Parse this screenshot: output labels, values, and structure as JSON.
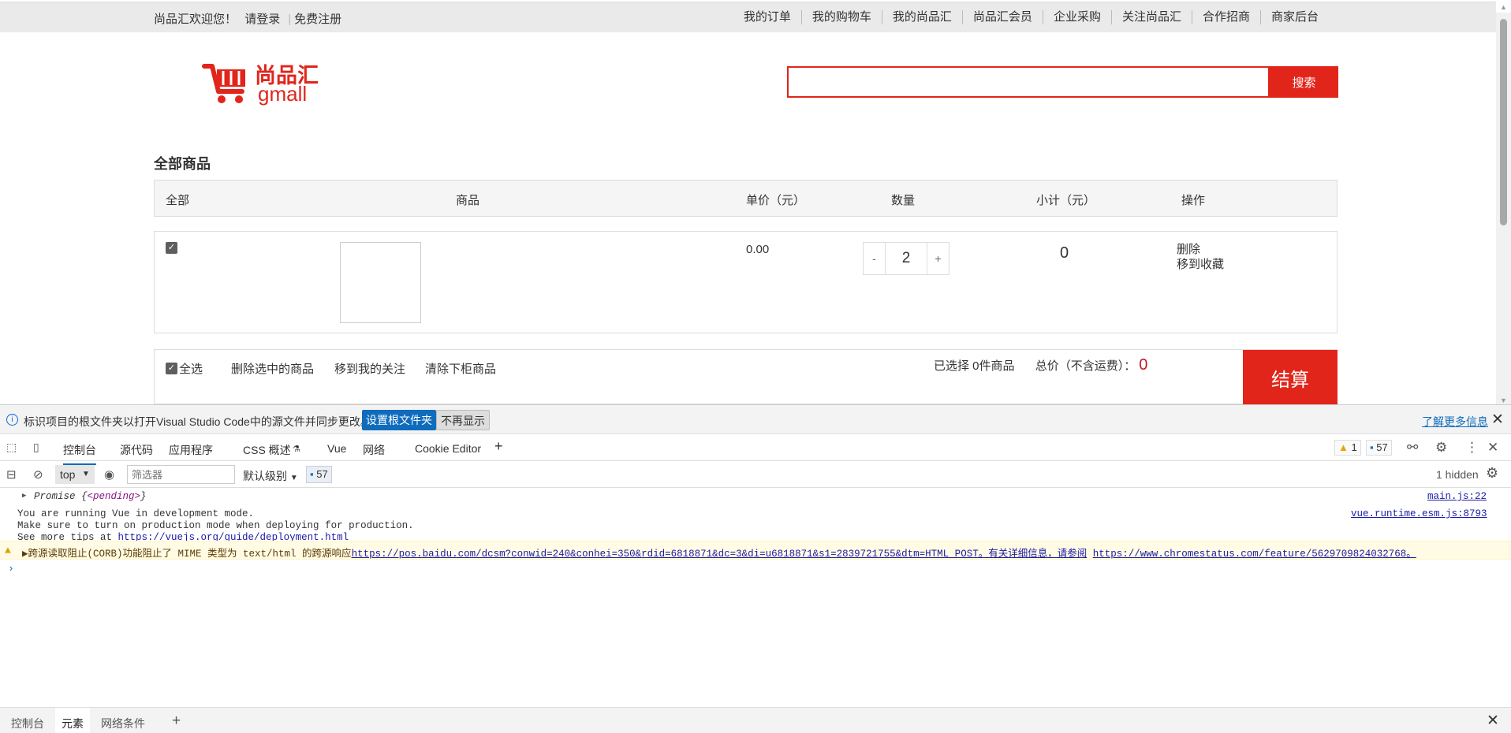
{
  "topbar": {
    "welcome": "尚品汇欢迎您！",
    "login": "请登录",
    "register": "免费注册",
    "nav": [
      "我的订单",
      "我的购物车",
      "我的尚品汇",
      "尚品汇会员",
      "企业采购",
      "关注尚品汇",
      "合作招商",
      "商家后台"
    ]
  },
  "logo": {
    "cn": "尚品汇",
    "en": "gmall"
  },
  "search": {
    "value": "",
    "button": "搜索"
  },
  "cart": {
    "title": "全部商品",
    "headers": [
      "全部",
      "商品",
      "单价（元）",
      "数量",
      "小计（元）",
      "操作"
    ],
    "items": [
      {
        "checked": true,
        "price": "0.00",
        "quantity": "2",
        "subtotal": "0",
        "op_delete": "删除",
        "op_favorite": "移到收藏",
        "minus": "-",
        "plus": "+"
      }
    ],
    "footer": {
      "select_all": "全选",
      "delete_selected": "删除选中的商品",
      "move_to_follow": "移到我的关注",
      "clear_off_shelf": "清除下柜商品",
      "selected_count": "已选择 0件商品",
      "total_label": "总价（不含运费）：",
      "total_value": "0",
      "checkout": "结算"
    }
  },
  "devtools": {
    "infobar": {
      "message": "标识项目的根文件夹以打开Visual Studio Code中的源文件并同步更改。",
      "set_root": "设置根文件夹",
      "dont_show": "不再显示",
      "learn_more": "了解更多信息"
    },
    "tabs": [
      "控制台",
      "源代码",
      "应用程序",
      "CSS 概述",
      "Vue",
      "网络",
      "Cookie Editor"
    ],
    "warn_count": "1",
    "msg_count": "57",
    "toolbar": {
      "context": "top",
      "filter_placeholder": "筛选器",
      "level": "默认级别",
      "count": "57",
      "hidden": "1 hidden"
    },
    "console": {
      "line1": {
        "prefix": "Promise {",
        "pending": "<pending>",
        "suffix": "}",
        "source": "main.js:22"
      },
      "line2": {
        "text1": "You are running Vue in development mode.",
        "text2": "Make sure to turn on production mode when deploying for production.",
        "text3": "See more tips at ",
        "link": "https://vuejs.org/guide/deployment.html",
        "source": "vue.runtime.esm.js:8793"
      },
      "line3": {
        "text": "▶跨源读取阻止(CORB)功能阻止了 MIME 类型为 text/html 的跨源响应",
        "link1": "https://pos.baidu.com/dcsm?conwid=240&conhei=350&rdid=6818871&dc=3&di=u6818871&s1=2839721755&dtm=HTML_POST。有关详细信息，请参阅",
        "link2": "https://www.chromestatus.com/feature/5629709824032768。"
      },
      "prompt": "›"
    },
    "drawer_tabs": [
      "控制台",
      "元素",
      "网络条件"
    ]
  },
  "colors": {
    "brand_red": "#e1251b",
    "devtools_blue": "#0f6cbd"
  }
}
